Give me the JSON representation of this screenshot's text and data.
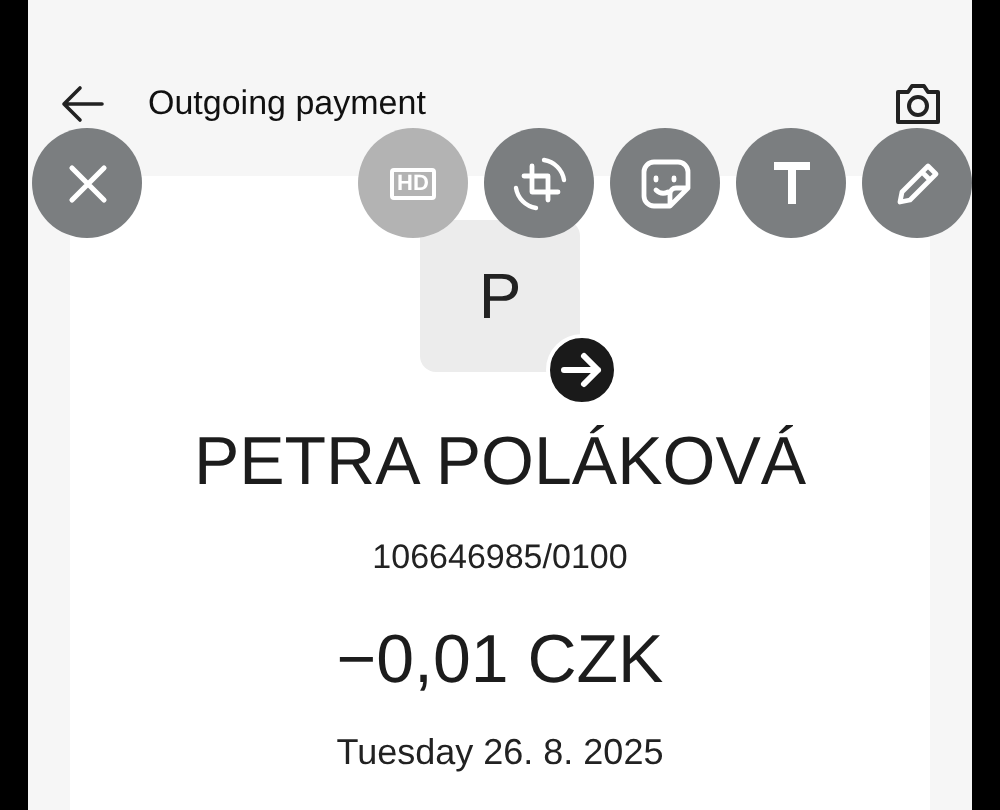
{
  "header": {
    "title": "Outgoing payment"
  },
  "editor_tools": [
    {
      "kind": "close",
      "disabled": false
    },
    {
      "kind": "hd",
      "label": "HD",
      "disabled": true
    },
    {
      "kind": "crop",
      "disabled": false
    },
    {
      "kind": "sticker",
      "disabled": false
    },
    {
      "kind": "text",
      "disabled": false
    },
    {
      "kind": "pen",
      "disabled": false
    }
  ],
  "payment": {
    "initial": "P",
    "name": "PETRA POLÁKOVÁ",
    "account": "106646985/0100",
    "amount": "−0,01 CZK",
    "date": "Tuesday 26. 8. 2025"
  }
}
